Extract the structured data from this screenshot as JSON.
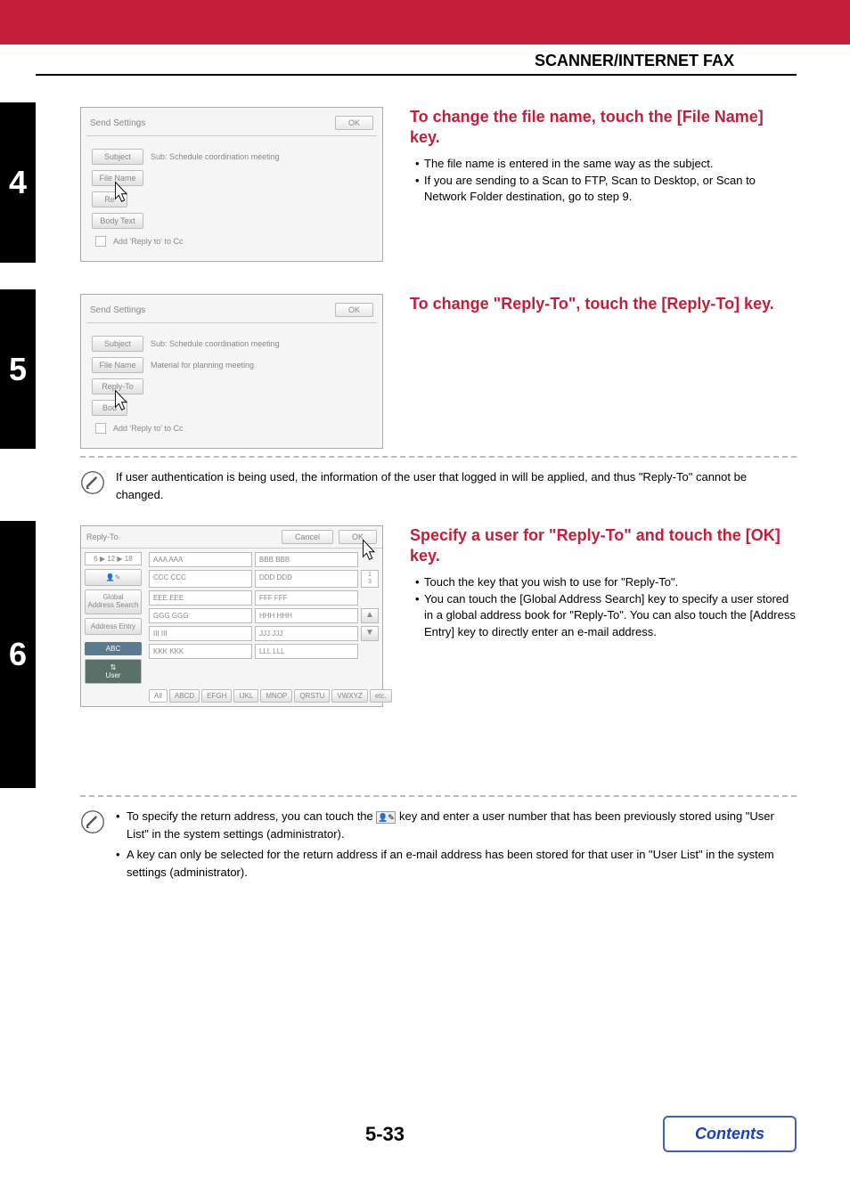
{
  "header": "SCANNER/INTERNET FAX",
  "steps": {
    "s4": {
      "num": "4",
      "panel": {
        "title": "Send Settings",
        "ok": "OK",
        "subjectBtn": "Subject",
        "subjectVal": "Sub: Schedule coordination meeting",
        "fileNameBtn": "File Name",
        "replyBtn": "Re",
        "bodyBtn": "Body Text",
        "addReply": "Add 'Reply to' to Cc"
      },
      "title": "To change the file name, touch the [File Name] key.",
      "bullets": [
        "The file name is entered in the same way as the subject.",
        "If you are sending to a Scan to FTP, Scan to Desktop, or Scan to Network Folder destination, go to step 9."
      ]
    },
    "s5": {
      "num": "5",
      "panel": {
        "title": "Send Settings",
        "ok": "OK",
        "subjectBtn": "Subject",
        "subjectVal": "Sub: Schedule coordination meeting",
        "fileNameBtn": "File Name",
        "fileNameVal": "Material for planning meeting",
        "replyBtn": "Reply-To",
        "bodyBtn": "Bod",
        "addReply": "Add 'Reply to' to Cc"
      },
      "title": "To change \"Reply-To\", touch the [Reply-To] key.",
      "note": "If user authentication is being used, the information of the user that logged in will be applied, and thus \"Reply-To\" cannot be changed."
    },
    "s6": {
      "num": "6",
      "panel": {
        "title": "Reply-To",
        "cancel": "Cancel",
        "ok": "OK",
        "pageSel": "6 ▶ 12 ▶ 18",
        "globalSearch": "Global\nAddress Search",
        "addressEntry": "Address Entry",
        "abc": "ABC",
        "user": "User",
        "cells": [
          "AAA AAA",
          "BBB BBB",
          "CCC CCC",
          "DDD DDD",
          "EEE EEE",
          "FFF FFF",
          "GGG GGG",
          "HHH HHH",
          "III III",
          "JJJ JJJ",
          "KKK KKK",
          "LLL LLL"
        ],
        "nums": [
          "1",
          "3"
        ],
        "tabs": [
          "All",
          "ABCD",
          "EFGH",
          "IJKL",
          "MNOP",
          "QRSTU",
          "VWXYZ",
          "etc."
        ]
      },
      "title": "Specify a user for \"Reply-To\" and touch the [OK] key.",
      "bullets": [
        "Touch the key that you wish to use for \"Reply-To\".",
        "You can touch the [Global Address Search] key to specify a user stored in a global address book for \"Reply-To\". You can also touch the [Address Entry] key to directly enter an e-mail address."
      ],
      "notes": [
        "To specify the return address, you can touch the ___ key and enter a user number that has been previously stored using \"User List\" in the system settings (administrator).",
        "A key can only be selected for the return address if an e-mail address has been stored for that user in \"User List\" in the system settings (administrator)."
      ]
    }
  },
  "pageNum": "5-33",
  "contents": "Contents"
}
